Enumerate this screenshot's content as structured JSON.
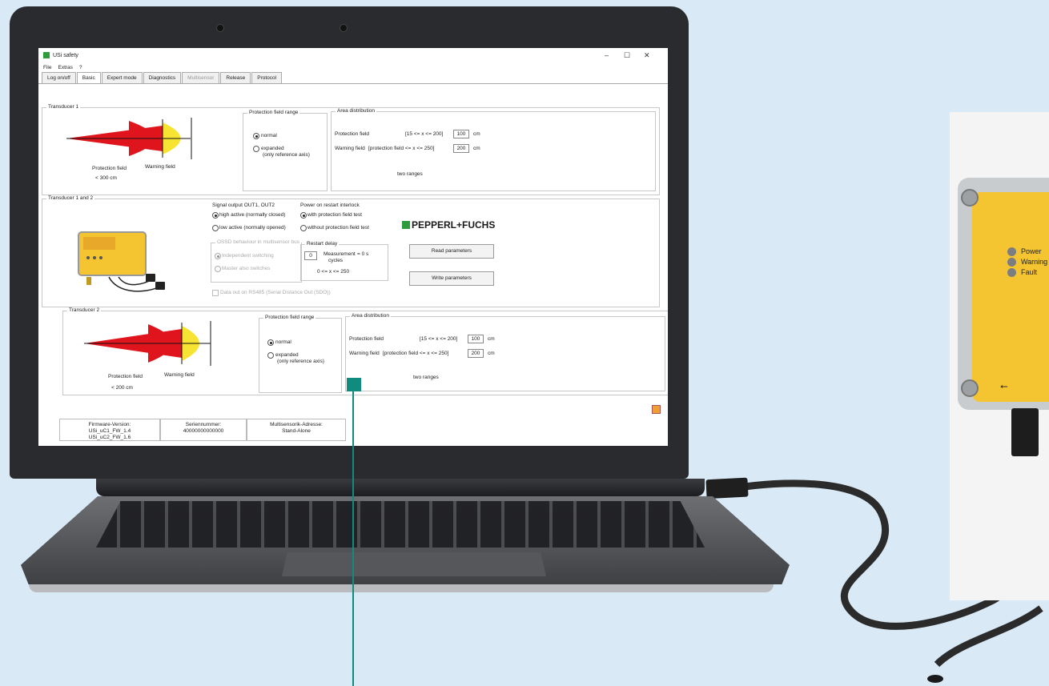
{
  "app": {
    "title": "USi safety",
    "window_controls": [
      "–",
      "☐",
      "✕"
    ],
    "menu": [
      "File",
      "Extras",
      "?"
    ],
    "tabs": [
      {
        "label": "Log on/off",
        "state": "normal"
      },
      {
        "label": "Basic",
        "state": "active"
      },
      {
        "label": "Expert mode",
        "state": "normal"
      },
      {
        "label": "Diagnostics",
        "state": "normal"
      },
      {
        "label": "Multisensor",
        "state": "disabled"
      },
      {
        "label": "Release",
        "state": "normal"
      },
      {
        "label": "Protocol",
        "state": "normal"
      }
    ]
  },
  "transducer1": {
    "title": "Transducer 1",
    "protection_label": "Protection field",
    "warning_label": "Warning field",
    "range_note": "< 300 cm",
    "pfr_title": "Protection field range",
    "opt_normal": "normal",
    "opt_expanded": "expanded",
    "opt_expanded_note": "(only reference axis)",
    "area_title": "Area distribution",
    "pf_label": "Protection field",
    "pf_range": "[15 <= x <= 200]",
    "pf_value": "100",
    "wf_label": "Warning field",
    "wf_range": "[protection field <= x <= 250]",
    "wf_value": "200",
    "unit": "cm",
    "two_ranges": "two ranges"
  },
  "transducer12": {
    "title": "Transducer 1 and 2",
    "signal_title": "Signal output OUT1, OUT2",
    "high_active": "high active (normally closed)",
    "low_active": "low active (normally opened)",
    "ossd_title": "OSSD behaviour in multisensor bus",
    "independent": "Independent switching",
    "master": "Master also switches",
    "power_title": "Power on restart interlock",
    "with_test": "with protection field test",
    "without_test": "without protection field test",
    "restart_title": "Restart delay",
    "restart_value": "0",
    "measurement": "Measurement",
    "cycles": "cycles",
    "equals": "= 0 s",
    "restart_range": "0 <= x <= 250",
    "data_out": "Data out on RS485 (Serial Distance Out (SDO))",
    "read_btn": "Read parameters",
    "write_btn": "Write parameters",
    "logo": "PEPPERL+FUCHS"
  },
  "transducer2": {
    "title": "Transducer 2",
    "protection_label": "Protection field",
    "warning_label": "Warning field",
    "range_note": "< 200 cm",
    "pfr_title": "Protection field range",
    "opt_normal": "normal",
    "opt_expanded": "expanded",
    "opt_expanded_note": "(only reference axis)",
    "area_title": "Area distribution",
    "pf_label": "Protection field",
    "pf_range": "[15 <= x <= 200]",
    "pf_value": "100",
    "wf_label": "Warning field",
    "wf_range": "[protection field <= x <= 250]",
    "wf_value": "200",
    "unit": "cm",
    "two_ranges": "two ranges"
  },
  "status": {
    "fw_label": "Firmware-Version:",
    "fw1": "USi_uC1_FW_1.4",
    "fw2": "USi_uC2_FW_1.6",
    "serial_label": "Seriennummer:",
    "serial": "40000000000000",
    "addr_label": "Multisensorik-Adresse:",
    "addr": "Stand-Alone"
  },
  "device": {
    "leds": [
      "Power",
      "Warning",
      "Fault"
    ],
    "usb_symbol": "⭠"
  },
  "colors": {
    "accent": "#0f8c7e",
    "protection": "#e0141c",
    "warning": "#f7e332",
    "device_yellow": "#f5c431"
  }
}
